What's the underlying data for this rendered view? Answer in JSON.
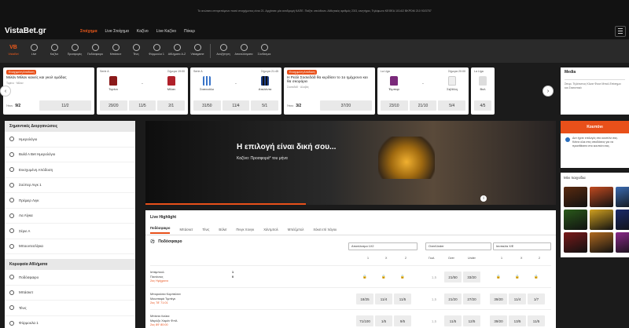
{
  "top_notice": "Το ανώτατο επιτρεπόμενο ποσό στοιχήματος είναι 21. Αρχίσατε μία αναδρομή ΚΑΠΕ. Παίξτε υπεύθυνα. Αθλητικός αριθμός 23/3, κινητήριο, Τηλέφωνο ΚΕΘΕΑ 1014/2 BKPDM 210 93/3757",
  "brand": "VistaBet.gr",
  "main_nav": [
    "Στοίχημα",
    "Live Στοίχημα",
    "Καζίνο",
    "Live Καζίνο",
    "Πόκερ"
  ],
  "sports_bar": [
    {
      "label": "VistaBet",
      "icon": "vb-logo-icon",
      "abbr": "VB"
    },
    {
      "label": "Live",
      "icon": "live-icon"
    },
    {
      "label": "Καζίνο",
      "icon": "casino-icon"
    },
    {
      "label": "Προσφορές",
      "icon": "promotions-icon"
    },
    {
      "label": "Ποδόσφαιρο",
      "icon": "football-icon"
    },
    {
      "label": "Μπάσκετ",
      "icon": "basketball-icon"
    },
    {
      "label": "Τένις",
      "icon": "tennis-icon"
    },
    {
      "label": "Φόρμουλα 1",
      "icon": "formula1-icon"
    },
    {
      "label": "Αθλήματα A-Z",
      "icon": "sports-az-icon"
    },
    {
      "label": "Vistagame",
      "icon": "vistagame-icon"
    },
    {
      "label": "Αναζήτηση",
      "icon": "search-icon"
    },
    {
      "label": "Αποτελέσματα",
      "icon": "results-icon"
    },
    {
      "label": "Σύνδεσμοι",
      "icon": "links-icon"
    }
  ],
  "cards": [
    {
      "tag": "Ενισχυμένη Απόδοση",
      "title": "Μιλάν Μίλαν κανείς και γκολ ομάδας",
      "sub": "Τορίνο · Μίλαν",
      "label": "Ήταν",
      "old": "9/2",
      "odd": "11/2"
    },
    {
      "league": "Serie A",
      "time": "Σήμερα 19:00",
      "home": "Τορίνο",
      "away": "Μίλαν",
      "odds": [
        "29/20",
        "11/5",
        "2/1"
      ],
      "home_color": "#8b1a1a",
      "away_color": "#b0202a"
    },
    {
      "league": "Serie A",
      "time": "Σήμερα 21:45",
      "home": "Σασουόλο",
      "away": "Αταλάντα",
      "odds": [
        "31/50",
        "11/4",
        "5/1"
      ],
      "home_color": "#3a74c8",
      "away_color": "#1d3f8a"
    },
    {
      "tag": "Ενισχυμένη Απόδοση",
      "title": "Η Ρεάλ Σοσιεδάδ θα κερδίσει το 1ο ημίχρονο και θα σκοράρει",
      "sub": "Σοσιεδάδ · Αλαβές",
      "label": "Ήταν",
      "old": "3/2",
      "odd": "37/20"
    },
    {
      "league": "La Liga",
      "time": "Σήμερα 20:00",
      "home": "Έιμπαρ",
      "away": "Σεβίλλη",
      "odds": [
        "23/10",
        "21/10",
        "5/4"
      ],
      "home_color": "#7a2a7a",
      "away_color": "#eeeeee"
    },
    {
      "league": "La Liga",
      "time": "",
      "home": "Βαλ",
      "away": "",
      "odds": [
        "4/5",
        "",
        ""
      ],
      "home_color": "#dddddd",
      "away_color": "#ffffff"
    }
  ],
  "sidebar": {
    "title": "Σημαντικές Διοργανώσεις",
    "items": [
      "Ημερολόγιο",
      "Build A Bet Ημερολόγιο",
      "Ενισχυμένη Απόδοση",
      "Σούπερ Λιγκ 1",
      "Πρέμιερ Λιγκ",
      "Λα Λίγκα",
      "Σέριε Α",
      "Μπουντεσλίγκα"
    ],
    "title2": "Κορυφαία Αθλήματα",
    "items2": [
      "Ποδόσφαιρο",
      "Μπάσκετ",
      "Τένις",
      "Φόρμουλα 1"
    ]
  },
  "banner": {
    "title": "Η επιλογή είναι δική σου...",
    "subtitle": "Καζίνο: Προσφορά* του μήνα",
    "info": "i"
  },
  "live": {
    "title": "Live Highlight",
    "tabs": [
      "Ποδόσφαιρο",
      "Μπάσκετ",
      "Τένις",
      "Βόλεϊ",
      "Πινγκ πονγκ",
      "Χάντμπολ",
      "Μπέιζμπολ",
      "Χόκεϊ επί πάγου"
    ],
    "sport": "Ποδόσφαιρο",
    "selects": [
      "Αποτέλεσμα 1Χ2",
      "Over/Under",
      "Ισοπαλία Χ/Ε"
    ],
    "col_heads": [
      "1",
      "X",
      "2",
      "Γκολ",
      "Over",
      "Under",
      "1",
      "X",
      "2"
    ],
    "matches": [
      {
        "home": "Ιστάμπουλ",
        "away": "Πανιόνιος",
        "status": "2ος Ημίχρονο",
        "score_h": "1",
        "score_a": "0",
        "odds": [
          "",
          "",
          "",
          "1,5",
          "21/50",
          "33/20",
          "",
          "",
          ""
        ],
        "locked": [
          true,
          true,
          true,
          false,
          false,
          false,
          true,
          true,
          true
        ]
      },
      {
        "home": "Μπορούσια Κορπάλτεν",
        "away": "Μουσταφά Τιμπέγκ",
        "status": "2ος 78' 71:01",
        "score_h": "",
        "score_a": "",
        "odds": [
          "18/25",
          "11/4",
          "11/5",
          "1,5",
          "21/20",
          "27/20",
          "39/20",
          "11/4",
          "1/7"
        ],
        "locked": [
          false,
          false,
          false,
          false,
          false,
          false,
          false,
          false,
          false
        ]
      },
      {
        "home": "Μπάνια Λούκα",
        "away": "Μαρόζκ Χαμόν Φπίλ",
        "status": "2ος 89' 80:00",
        "score_h": "",
        "score_a": "",
        "odds": [
          "71/100",
          "1/5",
          "9/5",
          "1,5",
          "11/5",
          "12/5",
          "39/20",
          "13/5",
          "11/5"
        ],
        "locked": [
          false,
          false,
          false,
          false,
          false,
          false,
          false,
          false,
          false
        ]
      }
    ]
  },
  "right": {
    "media_title": "Media",
    "media_text": "Σπορ. Τηλέτυπος Κλεισ Φουτ Μπολ Επίσημα και Στατιστικά",
    "coupon": "Κουπόνι",
    "coupon_text": "Δεν έχετε επιλογές στο κουπόνι σας. Κάντε κλικ στις αποδόσεις για να προσθέσετε στο κουπόνι σας.",
    "games_title": "Μίνι παιχνίδια",
    "game_colors": [
      "#5a2a10",
      "#c04a20",
      "#3a6ab0",
      "#2a5a1a",
      "#d0a020",
      "#1a2a6a",
      "#7a1a1a",
      "#b06a20",
      "#8a2a8a"
    ]
  }
}
